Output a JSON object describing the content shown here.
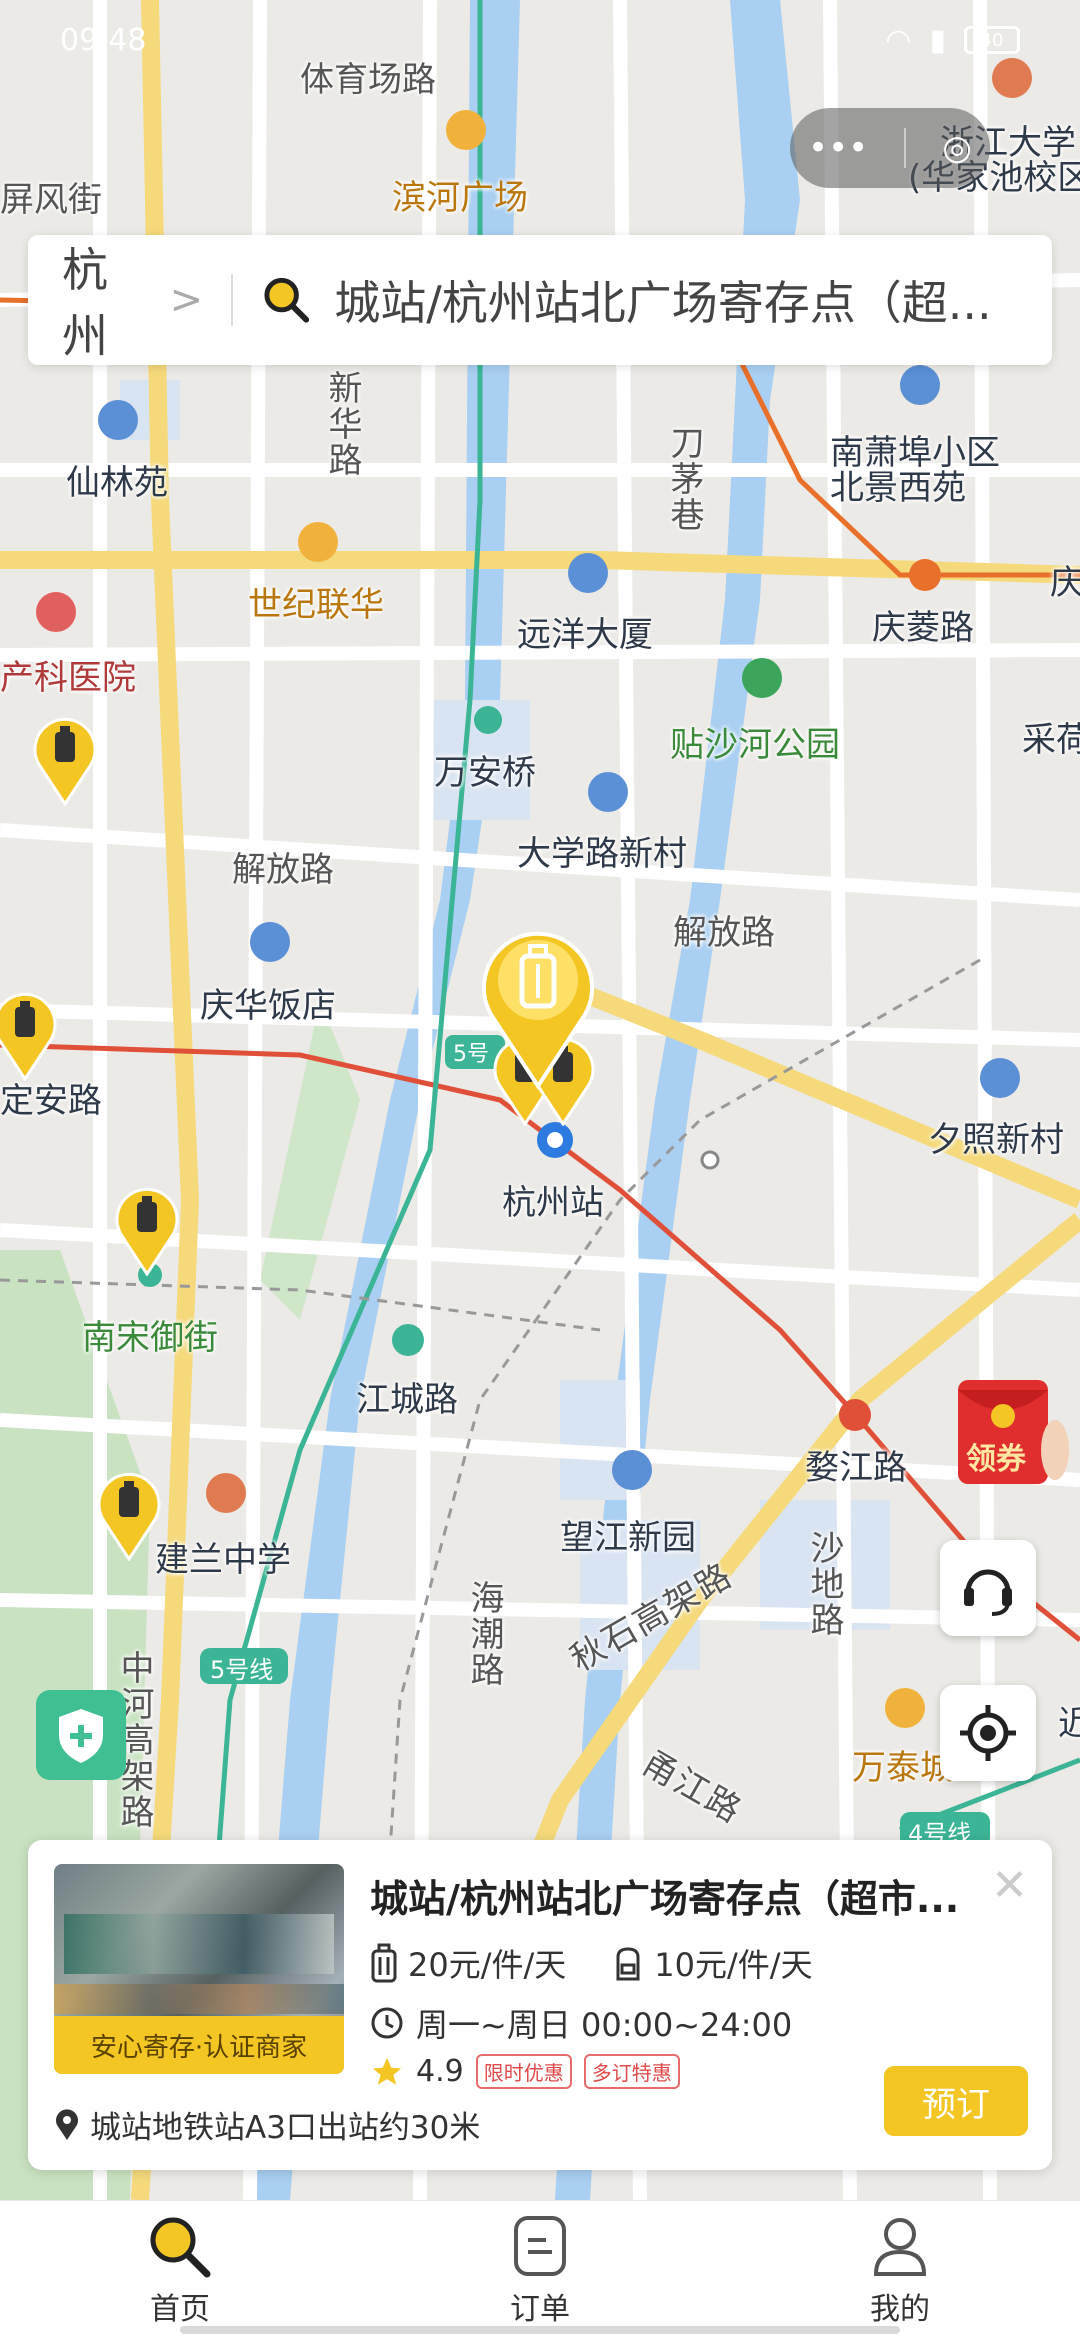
{
  "status_bar": {
    "time": "09:48",
    "battery": "40"
  },
  "miniapp": {
    "more": "•••",
    "close": "◎"
  },
  "search": {
    "city": "杭州",
    "query": "城站/杭州站北广场寄存点（超..."
  },
  "map_labels": [
    {
      "text": "体育场路",
      "cls": "road"
    },
    {
      "text": "滨河广场",
      "cls": "orange"
    },
    {
      "text": "浙江大学",
      "cls": ""
    },
    {
      "text": "(华家池校区",
      "cls": ""
    },
    {
      "text": "屏风街",
      "cls": "road"
    },
    {
      "text": "新华路",
      "cls": "road"
    },
    {
      "text": "刀茅巷",
      "cls": "road"
    },
    {
      "text": "南萧埠小区",
      "cls": ""
    },
    {
      "text": "北景西苑",
      "cls": ""
    },
    {
      "text": "仙林苑",
      "cls": ""
    },
    {
      "text": "世纪联华",
      "cls": "orange"
    },
    {
      "text": "远洋大厦",
      "cls": ""
    },
    {
      "text": "庆菱路",
      "cls": ""
    },
    {
      "text": "产科医院",
      "cls": "red"
    },
    {
      "text": "贴沙河公园",
      "cls": "green"
    },
    {
      "text": "采荷",
      "cls": ""
    },
    {
      "text": "万安桥",
      "cls": ""
    },
    {
      "text": "大学路新村",
      "cls": ""
    },
    {
      "text": "解放路",
      "cls": "road"
    },
    {
      "text": "解放路",
      "cls": "road"
    },
    {
      "text": "庆华饭店",
      "cls": ""
    },
    {
      "text": "定安路",
      "cls": ""
    },
    {
      "text": "夕照新村",
      "cls": ""
    },
    {
      "text": "杭州站",
      "cls": ""
    },
    {
      "text": "南宋御街",
      "cls": "green"
    },
    {
      "text": "江城路",
      "cls": ""
    },
    {
      "text": "婺江路",
      "cls": ""
    },
    {
      "text": "望江新园",
      "cls": ""
    },
    {
      "text": "建兰中学",
      "cls": ""
    },
    {
      "text": "海潮路",
      "cls": "road"
    },
    {
      "text": "沙地路",
      "cls": "road"
    },
    {
      "text": "秋石高架路",
      "cls": "road"
    },
    {
      "text": "中河高架路",
      "cls": "road"
    },
    {
      "text": "万泰城",
      "cls": "orange"
    },
    {
      "text": "甬江路",
      "cls": "road"
    },
    {
      "text": "庆",
      "cls": ""
    },
    {
      "text": "近",
      "cls": ""
    }
  ],
  "metro_badges": [
    "5号",
    "5号线",
    "4号线"
  ],
  "coupon_label": "领券",
  "card": {
    "title": "城站/杭州站北广场寄存点（超市...",
    "badge": "安心寄存·认证商家",
    "price_large": "20元/件/天",
    "price_small": "10元/件/天",
    "hours": "周一~周日 00:00~24:00",
    "rating": "4.9",
    "tags": [
      "限时优惠",
      "多订特惠"
    ],
    "address": "城站地铁站A3口出站约30米",
    "book_label": "预订"
  },
  "tabs": [
    {
      "label": "首页",
      "icon": "search-icon"
    },
    {
      "label": "订单",
      "icon": "order-icon"
    },
    {
      "label": "我的",
      "icon": "profile-icon"
    }
  ]
}
